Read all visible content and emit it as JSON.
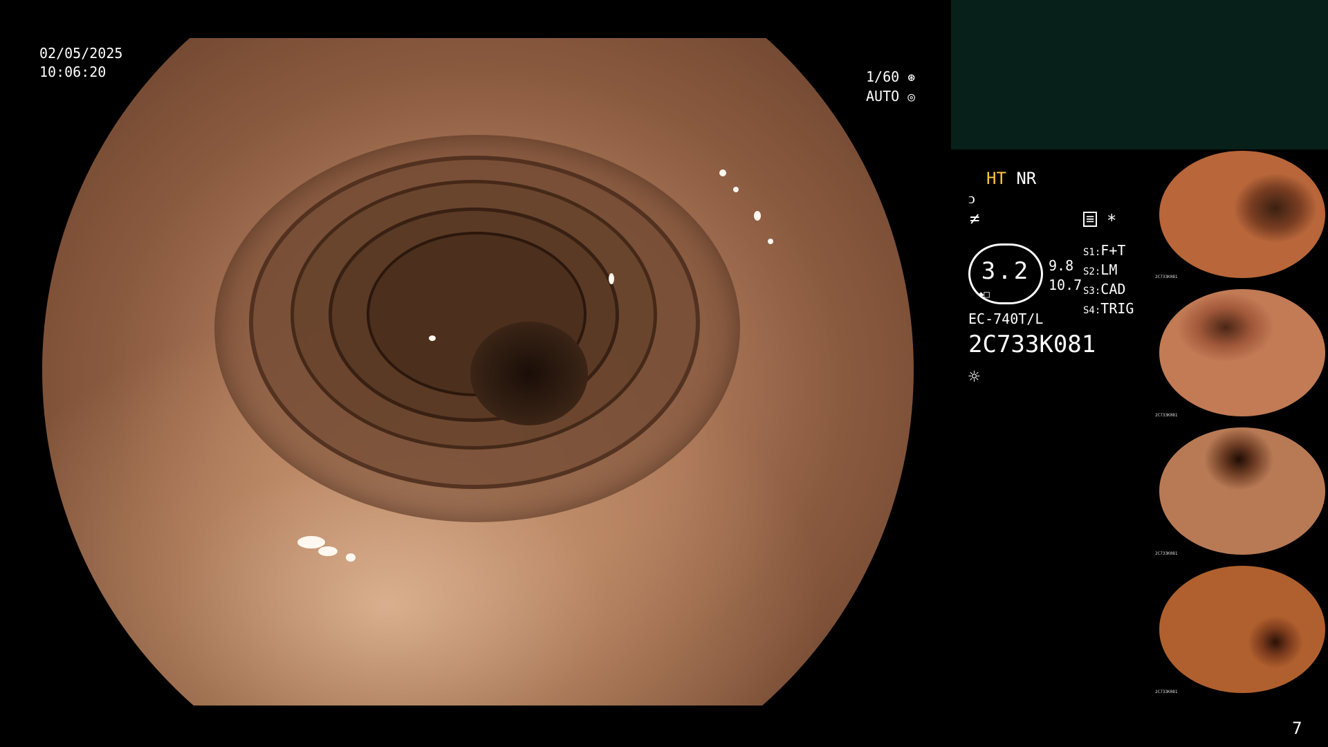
{
  "overlay": {
    "date": "02/05/2025",
    "time": "10:06:20",
    "shutter": "1/60",
    "exposure": "AUTO",
    "page_number": "7"
  },
  "panel": {
    "mode_ht": "HT",
    "mode_nr": "NR",
    "zoom": "3.2",
    "values": [
      "9.8",
      "10.7"
    ],
    "switches": [
      {
        "key": "S1:",
        "value": "F+T"
      },
      {
        "key": "S2:",
        "value": "LM"
      },
      {
        "key": "S3:",
        "value": "CAD"
      },
      {
        "key": "S4:",
        "value": "TRIG"
      }
    ],
    "scope_model": "EC-740T/L",
    "serial": "2C733K081",
    "asterisk": "*"
  },
  "thumbnails": [
    {
      "label": "2C733K081"
    },
    {
      "label": "2C733K081"
    },
    {
      "label": "2C733K081"
    },
    {
      "label": "2C733K081"
    }
  ],
  "colors": {
    "accent_ht": "#ffc640",
    "panel_box": "#072019"
  },
  "icons": [
    "shutter-icon",
    "auto-exposure-icon",
    "curve-icon",
    "enhance-icon",
    "record-icon",
    "light-source-icon"
  ]
}
